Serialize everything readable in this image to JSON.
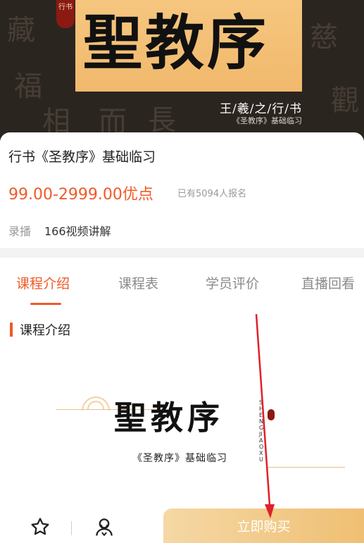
{
  "banner": {
    "seal_text": "行书",
    "main_title": "聖教序",
    "subtitle": "王/羲/之/行/书",
    "subtitle_small": "《圣教序》基础临习"
  },
  "course": {
    "title": "行书《圣教序》基础临习",
    "price": "99.00-2999.00优点",
    "enrolled": "已有5094人报名",
    "mode": "录播",
    "videos": "166视频讲解"
  },
  "tabs": [
    {
      "label": "课程介绍",
      "active": true
    },
    {
      "label": "课程表",
      "active": false
    },
    {
      "label": "学员评价",
      "active": false
    },
    {
      "label": "直播回看",
      "active": false
    }
  ],
  "section": {
    "heading": "课程介绍"
  },
  "intro_image": {
    "title": "聖教序",
    "subtitle": "《圣教序》基础临习",
    "vertical_text": "SHENG JIAO XU"
  },
  "bottom_bar": {
    "buy_label": "立即购买",
    "favorite_icon": "star-outline-icon",
    "service_icon": "user-service-icon"
  },
  "colors": {
    "accent": "#f05a28",
    "gold": "#f1b96c",
    "annotation": "#e0202a"
  }
}
